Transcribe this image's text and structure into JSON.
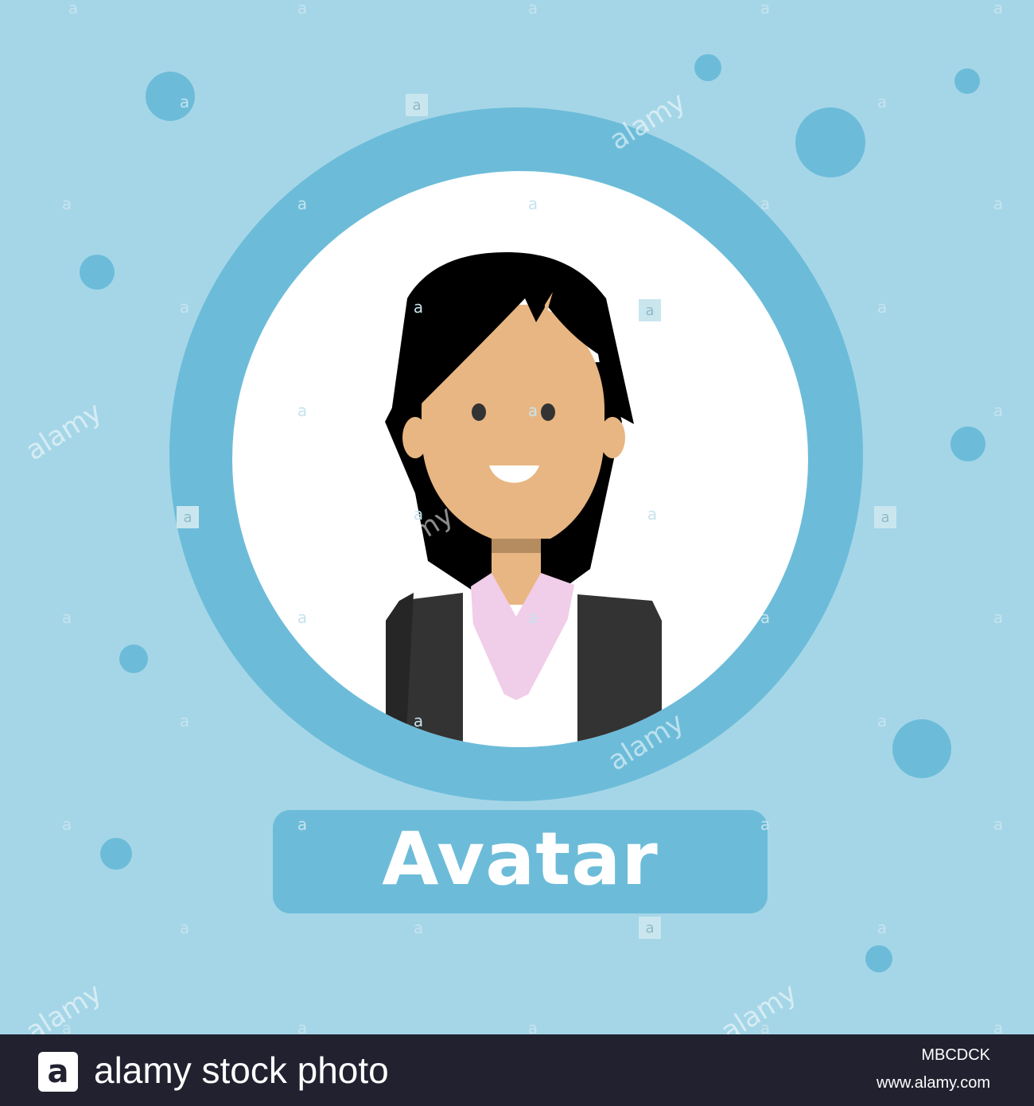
{
  "illustration": {
    "label": "Avatar",
    "colors": {
      "background": "#a5d6e7",
      "accent": "#6cbcd9",
      "disc": "#ffffff",
      "hair": "#000000",
      "skin": "#e8b682",
      "neck_shadow": "#b58c5f",
      "jacket": "#333333",
      "collar": "#f0cde8"
    }
  },
  "watermark": {
    "letter": "a",
    "word": "alamy"
  },
  "footer": {
    "logo_letter": "a",
    "brand": "alamy stock photo",
    "image_id": "MBCDCK",
    "url": "www.alamy.com"
  }
}
